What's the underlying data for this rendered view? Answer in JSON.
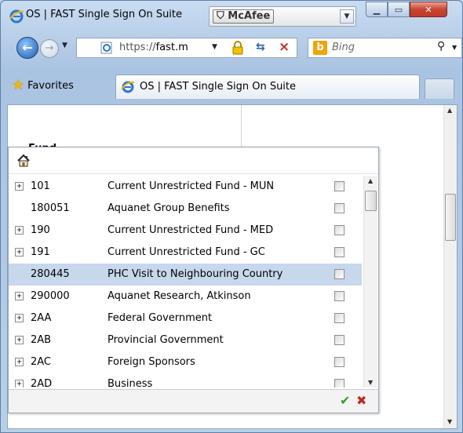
{
  "window": {
    "title": "OS | FAST Single Sign On Suite",
    "mcafee_label": "McAfee"
  },
  "nav": {
    "address_prefix": "https://",
    "address_host": "fast.m",
    "search_placeholder": "Bing"
  },
  "favorites": {
    "label": "Favorites",
    "tab_label": "OS | FAST Single Sign On Suite"
  },
  "page": {
    "fund_label": "Fund"
  },
  "fund_list": {
    "rows": [
      {
        "code": "101",
        "description": "Current Unrestricted Fund - MUN",
        "expandable": true,
        "selected": false,
        "checked": false
      },
      {
        "code": "180051",
        "description": "Aquanet Group Benefits",
        "expandable": false,
        "selected": false,
        "checked": false
      },
      {
        "code": "190",
        "description": "Current Unrestricted Fund - MED",
        "expandable": true,
        "selected": false,
        "checked": false
      },
      {
        "code": "191",
        "description": "Current Unrestricted Fund - GC",
        "expandable": true,
        "selected": false,
        "checked": false
      },
      {
        "code": "280445",
        "description": "PHC Visit to Neighbouring Country",
        "expandable": false,
        "selected": true,
        "checked": false
      },
      {
        "code": "290000",
        "description": "Aquanet Research, Atkinson",
        "expandable": true,
        "selected": false,
        "checked": false
      },
      {
        "code": "2AA",
        "description": "Federal Government",
        "expandable": true,
        "selected": false,
        "checked": false
      },
      {
        "code": "2AB",
        "description": "Provincial Government",
        "expandable": true,
        "selected": false,
        "checked": false
      },
      {
        "code": "2AC",
        "description": "Foreign Sponsors",
        "expandable": true,
        "selected": false,
        "checked": false
      },
      {
        "code": "2AD",
        "description": "Business",
        "expandable": true,
        "selected": false,
        "checked": false
      }
    ]
  },
  "colors": {
    "selected_row": "#c7d7ec",
    "ok": "#3a9a2f",
    "cancel": "#c0281e"
  }
}
